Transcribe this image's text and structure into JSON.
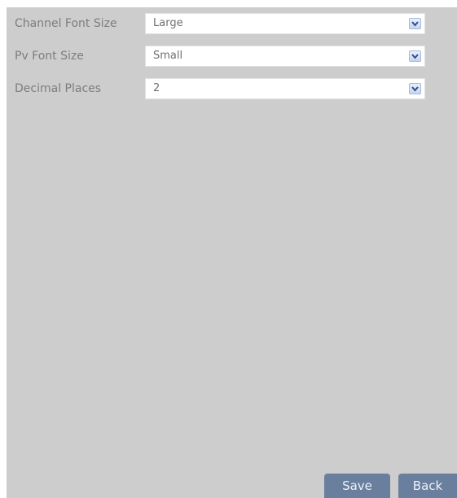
{
  "settings": {
    "rows": [
      {
        "label": "Channel Font Size",
        "value": "Large"
      },
      {
        "label": "Pv Font Size",
        "value": "Small"
      },
      {
        "label": "Decimal Places",
        "value": "2"
      }
    ]
  },
  "buttons": {
    "save_label": "Save",
    "back_label": "Back"
  },
  "icons": {
    "dropdown": "chevron-down-icon"
  },
  "colors": {
    "panel_bg": "#cdcdcd",
    "button_bg": "#6a7f9e",
    "label_text": "#7d7d7d"
  }
}
